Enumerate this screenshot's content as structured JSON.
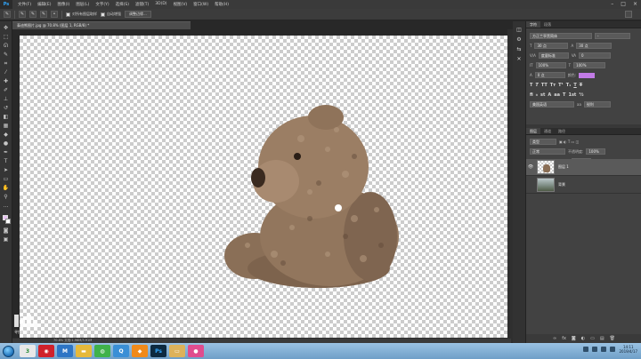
{
  "app": {
    "logo": "Ps"
  },
  "menu": [
    "文件(F)",
    "编辑(E)",
    "图像(I)",
    "图层(L)",
    "文字(Y)",
    "选择(S)",
    "滤镜(T)",
    "3D(D)",
    "视图(V)",
    "窗口(W)",
    "帮助(H)"
  ],
  "options": {
    "sample_all_label": "对所有图层取样",
    "auto_enhance_label": "自动增强",
    "refine_edge_label": "调整边缘..."
  },
  "document": {
    "tab_title": "泰迪熊图片.jpg @ 70.8% (图层 1, RGB/8) *",
    "status": "70.8%  文档:1.96M/3.91M"
  },
  "watermark": {
    "text": "寻找设计"
  },
  "char_panel": {
    "tabs": [
      "字符",
      "段落"
    ],
    "font_family": "方正兰亭黑简体",
    "font_style": "-",
    "size": "30 点",
    "leading": "30 点",
    "tracking": "0",
    "kerning": "度量标准",
    "vscale": "100%",
    "hscale": "100%",
    "baseline": "0 点",
    "color_label": "颜色:",
    "language": "美国英语",
    "antialias": "锐利",
    "text_color": "#c27be6"
  },
  "layers_panel": {
    "tabs": [
      "图层",
      "通道",
      "路径"
    ],
    "kind_filter": "类型",
    "blend_mode": "正常",
    "opacity_label": "不透明度:",
    "opacity": "100%",
    "lock_label": "锁定:",
    "fill_label": "填充:",
    "fill": "100%",
    "layers": [
      {
        "name": "图层 1",
        "selected": true
      },
      {
        "name": "背景",
        "selected": false
      }
    ]
  },
  "taskbar": {
    "apps": [
      {
        "name": "360",
        "color": "#e8e8e8",
        "label": "3"
      },
      {
        "name": "netease",
        "color": "#d0212b",
        "label": "◉"
      },
      {
        "name": "maxthon",
        "color": "#2d75c5",
        "label": "M"
      },
      {
        "name": "explorer",
        "color": "#e6b93a",
        "label": "▬"
      },
      {
        "name": "wechat",
        "color": "#3fb24a",
        "label": "◍"
      },
      {
        "name": "qq",
        "color": "#3a8fd6",
        "label": "Q"
      },
      {
        "name": "orange-app",
        "color": "#f08a1a",
        "label": "◆"
      },
      {
        "name": "photoshop",
        "color": "#0d2a40",
        "label": "Ps"
      },
      {
        "name": "folder",
        "color": "#ddb25a",
        "label": "▭"
      },
      {
        "name": "pink-app",
        "color": "#e04c8e",
        "label": "●"
      }
    ],
    "time": "14:11",
    "date": "2019/4/17"
  }
}
